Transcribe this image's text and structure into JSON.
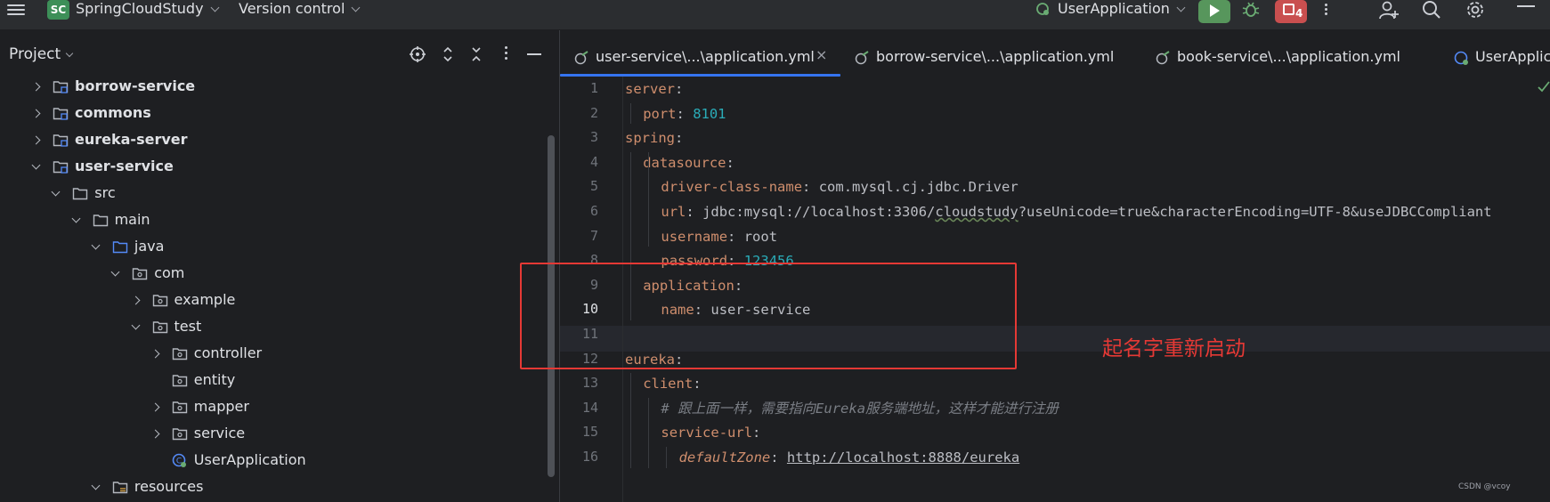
{
  "toolbar": {
    "project_badge": "SC",
    "project_name": "SpringCloudStudy",
    "version_control": "Version control",
    "run_config": "UserApplication",
    "stop_count": "4"
  },
  "project_panel": {
    "title": "Project",
    "tree": [
      {
        "label": "borrow-service",
        "depth": 1,
        "state": "collapsed",
        "icon": "module-folder-icon",
        "bold": true
      },
      {
        "label": "commons",
        "depth": 1,
        "state": "collapsed",
        "icon": "module-folder-icon",
        "bold": true
      },
      {
        "label": "eureka-server",
        "depth": 1,
        "state": "collapsed",
        "icon": "module-folder-icon",
        "bold": true
      },
      {
        "label": "user-service",
        "depth": 1,
        "state": "expanded",
        "icon": "module-folder-icon",
        "bold": true
      },
      {
        "label": "src",
        "depth": 2,
        "state": "expanded",
        "icon": "folder-icon",
        "bold": false
      },
      {
        "label": "main",
        "depth": 3,
        "state": "expanded",
        "icon": "folder-icon",
        "bold": false
      },
      {
        "label": "java",
        "depth": 4,
        "state": "expanded",
        "icon": "source-folder-icon",
        "bold": false
      },
      {
        "label": "com",
        "depth": 5,
        "state": "expanded",
        "icon": "package-icon",
        "bold": false
      },
      {
        "label": "example",
        "depth": 6,
        "state": "collapsed",
        "icon": "package-icon",
        "bold": false
      },
      {
        "label": "test",
        "depth": 6,
        "state": "expanded",
        "icon": "package-icon",
        "bold": false
      },
      {
        "label": "controller",
        "depth": 7,
        "state": "collapsed",
        "icon": "package-icon",
        "bold": false
      },
      {
        "label": "entity",
        "depth": 7,
        "state": "none",
        "icon": "package-icon",
        "bold": false
      },
      {
        "label": "mapper",
        "depth": 7,
        "state": "collapsed",
        "icon": "package-icon",
        "bold": false
      },
      {
        "label": "service",
        "depth": 7,
        "state": "collapsed",
        "icon": "package-icon",
        "bold": false
      },
      {
        "label": "UserApplication",
        "depth": 7,
        "state": "none",
        "icon": "spring-boot-class-icon",
        "bold": false
      },
      {
        "label": "resources",
        "depth": 4,
        "state": "expanded",
        "icon": "resources-folder-icon",
        "bold": false
      }
    ]
  },
  "editor": {
    "tabs": [
      {
        "label": "user-service\\...\\application.yml",
        "active": true,
        "closable": true
      },
      {
        "label": "borrow-service\\...\\application.yml",
        "active": false,
        "closable": false
      },
      {
        "label": "book-service\\...\\application.yml",
        "active": false,
        "closable": false
      },
      {
        "label": "UserApplica",
        "active": false,
        "closable": false
      }
    ],
    "close_glyph": "×",
    "current_line": 10,
    "lines": [
      {
        "num": "1",
        "indent": 0,
        "key": "server",
        "sep": ":",
        "value": ""
      },
      {
        "num": "2",
        "indent": 1,
        "key": "port",
        "sep": ": ",
        "value": "8101",
        "vtype": "n"
      },
      {
        "num": "3",
        "indent": 0,
        "key": "spring",
        "sep": ":",
        "value": ""
      },
      {
        "num": "4",
        "indent": 1,
        "key": "datasource",
        "sep": ":",
        "value": ""
      },
      {
        "num": "5",
        "indent": 2,
        "key": "driver-class-name",
        "sep": ": ",
        "value": "com.mysql.cj.jdbc.Driver",
        "vtype": "v"
      },
      {
        "num": "6",
        "indent": 2,
        "key": "url",
        "sep": ": ",
        "value": "jdbc:mysql://localhost:3306/cloudstudy?useUnicode=true&characterEncoding=UTF-8&useJDBCCompliant",
        "vtype": "url"
      },
      {
        "num": "7",
        "indent": 2,
        "key": "username",
        "sep": ": ",
        "value": "root",
        "vtype": "v"
      },
      {
        "num": "8",
        "indent": 2,
        "key": "password",
        "sep": ": ",
        "value": "123456",
        "vtype": "n"
      },
      {
        "num": "9",
        "indent": 1,
        "key": "application",
        "sep": ":",
        "value": ""
      },
      {
        "num": "10",
        "indent": 2,
        "key": "name",
        "sep": ": ",
        "value": "user-service",
        "vtype": "v"
      },
      {
        "num": "11",
        "indent": 0,
        "key": "",
        "sep": "",
        "value": ""
      },
      {
        "num": "12",
        "indent": 0,
        "key": "eureka",
        "sep": ":",
        "value": ""
      },
      {
        "num": "13",
        "indent": 1,
        "key": "client",
        "sep": ":",
        "value": ""
      },
      {
        "num": "14",
        "indent": 2,
        "key": "",
        "sep": "",
        "value": "# 跟上面一样，需要指向Eureka服务端地址，这样才能进行注册",
        "vtype": "c"
      },
      {
        "num": "15",
        "indent": 2,
        "key": "service-url",
        "sep": ":",
        "value": ""
      },
      {
        "num": "16",
        "indent": 3,
        "key": "defaultZone",
        "sep": ": ",
        "value": "http://localhost:8888/eureka",
        "vtype": "u",
        "keystyle": "kd"
      }
    ]
  },
  "annotation": "起名字重新启动",
  "watermark": "CSDN @vcoy"
}
